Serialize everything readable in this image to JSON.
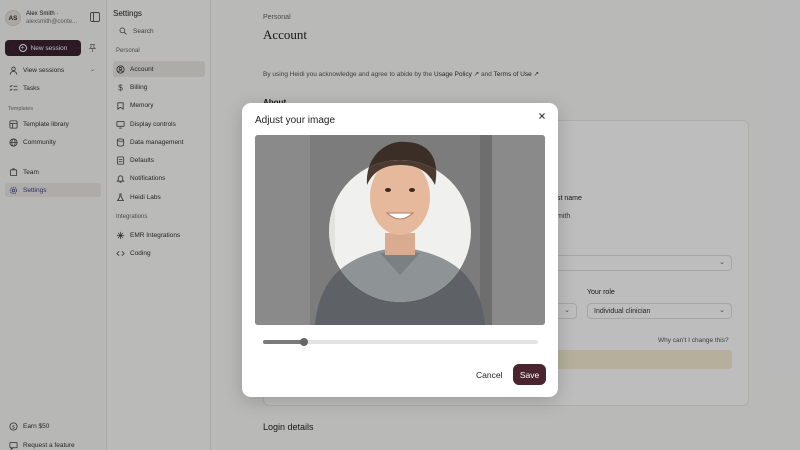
{
  "user": {
    "initials": "AS",
    "name": "Alex Smith ·",
    "email": "alexsmith@conte..."
  },
  "nav": {
    "new_session": "New session",
    "view_sessions": "View sessions",
    "tasks": "Tasks",
    "templates_section": "Templates",
    "template_library": "Template library",
    "community": "Community",
    "team": "Team",
    "settings": "Settings",
    "earn": "Earn $50",
    "request_feature": "Request a feature"
  },
  "settings_menu": {
    "title": "Settings",
    "search_placeholder": "Search",
    "personal_section": "Personal",
    "items": [
      "Account",
      "Billing",
      "Memory",
      "Display controls",
      "Data management",
      "Defaults",
      "Notifications",
      "Heidi Labs"
    ],
    "integrations_section": "Integrations",
    "integration_items": [
      "EMR Integrations",
      "Coding"
    ]
  },
  "main": {
    "breadcrumb": "Personal",
    "title": "Account",
    "consent_text": "By using Heidi you acknowledge and agree to abide by the",
    "usage_policy": "Usage Policy",
    "and": "and",
    "terms": "Terms of Use",
    "about_heading": "About",
    "last_name_label": "st name",
    "last_name_value": "mith",
    "role_label": "Your role",
    "role_value": "Individual clinician",
    "why_text": "Why can't I change this?",
    "login_heading": "Login details"
  },
  "modal": {
    "title": "Adjust your image",
    "cancel": "Cancel",
    "save": "Save",
    "zoom_fraction": 0.15
  },
  "colors": {
    "primary": "#4a2530",
    "new_session_bg": "#3b2230",
    "notice_bg": "#f4ecd2"
  },
  "icons": [
    "collapse-sidebar-icon",
    "plus-circle-icon",
    "pin-icon",
    "person-icon",
    "tasks-icon",
    "template-icon",
    "globe-icon",
    "team-icon",
    "gear-icon",
    "gift-icon",
    "chat-icon",
    "search-icon",
    "account-icon",
    "dollar-icon",
    "memory-icon",
    "monitor-icon",
    "database-icon",
    "defaults-icon",
    "bell-icon",
    "labs-icon",
    "integration-icon",
    "code-icon",
    "close-icon",
    "external-link-icon"
  ]
}
